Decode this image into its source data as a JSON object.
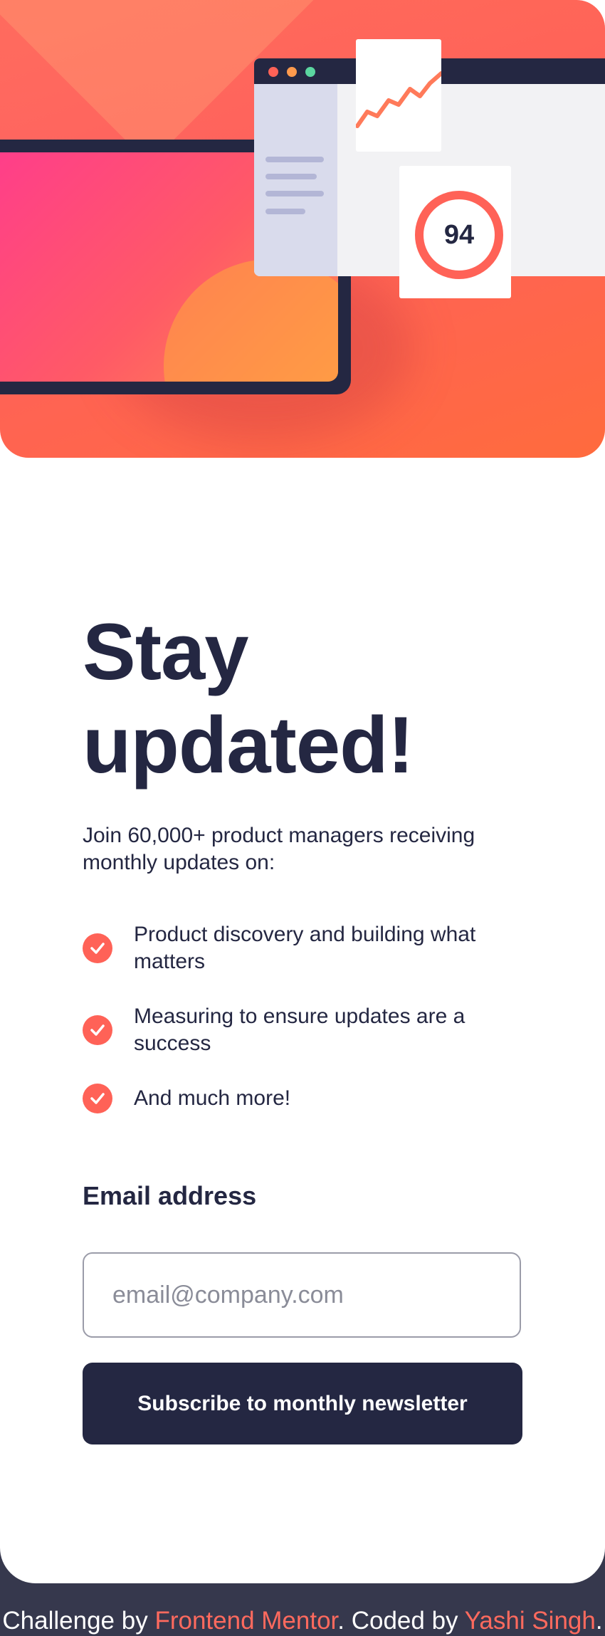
{
  "hero": {
    "score": "94",
    "colors": {
      "accent": "#ff6257",
      "dark": "#242742"
    },
    "illustration_icons": [
      "window-dots-icon",
      "line-chart-icon",
      "score-ring-icon"
    ]
  },
  "title": {
    "line1": "Stay",
    "line2": "updated!"
  },
  "intro": "Join 60,000+ product managers receiving monthly updates on:",
  "features": [
    "Product discovery and building what matters",
    "Measuring to ensure updates are a success",
    "And much more!"
  ],
  "form": {
    "label": "Email address",
    "placeholder": "email@company.com",
    "button_label": "Subscribe to monthly newsletter"
  },
  "footer": {
    "prefix": "Challenge by ",
    "challenge_link": "Frontend Mentor",
    "middle": ". Coded by ",
    "author_link": "Yashi Singh",
    "suffix": "."
  }
}
